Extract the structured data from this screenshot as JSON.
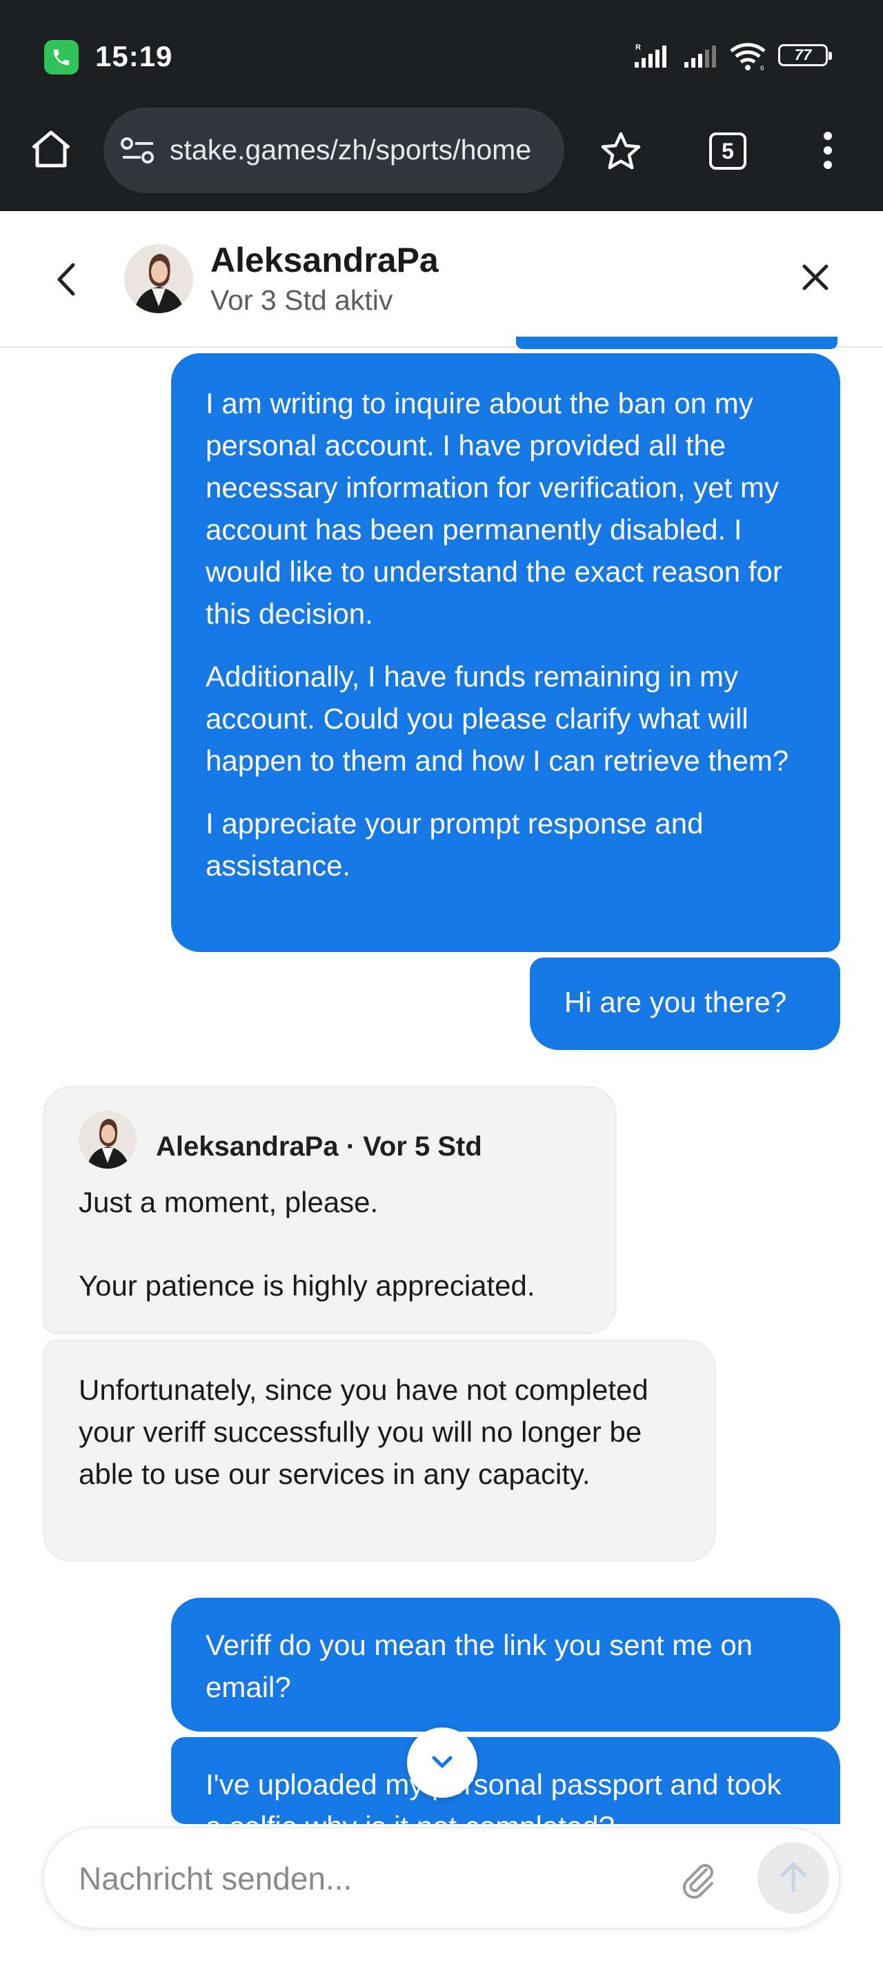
{
  "status_bar": {
    "time": "15:19",
    "battery": "77",
    "icons": [
      "call-icon",
      "signal-icon",
      "signal-icon",
      "wifi-icon",
      "battery-icon"
    ]
  },
  "browser": {
    "url": "stake.games/zh/sports/home",
    "tab_count": "5",
    "icons": [
      "home-icon",
      "site-settings-icon",
      "star-icon",
      "tabs-icon",
      "menu-icon"
    ]
  },
  "chat_header": {
    "agent_name": "AleksandraPa",
    "agent_status": "Vor 3 Std aktiv"
  },
  "messages": {
    "out1": {
      "paragraphs": [
        "I am writing to inquire about the ban on my personal account. I have provided all the necessary information for verification, yet my account has been permanently disabled. I would like to understand the exact reason for this decision.",
        "Additionally, I have funds remaining in my account. Could you please clarify what will happen to them and how I can retrieve them?",
        "I appreciate your prompt response and assistance."
      ]
    },
    "out2": {
      "text": "Hi are you there?"
    },
    "in1": {
      "sender": "AleksandraPa",
      "time": "Vor 5 Std",
      "line1": "Just a moment, please.",
      "line2": "Your patience is highly appreciated."
    },
    "in2": {
      "text": "Unfortunately, since you have not completed your veriff successfully you will no longer be able to use our services in any capacity."
    },
    "out3": {
      "text": "Veriff do you mean the link you sent me on email?"
    },
    "out4": {
      "text": "I've uploaded my personal passport and took a selfie why is it not completed?"
    }
  },
  "composer": {
    "placeholder": "Nachricht senden..."
  },
  "colors": {
    "outgoing_bubble": "#1578e5",
    "incoming_bubble": "#f3f3f3",
    "status_bar": "#1c1f22"
  }
}
